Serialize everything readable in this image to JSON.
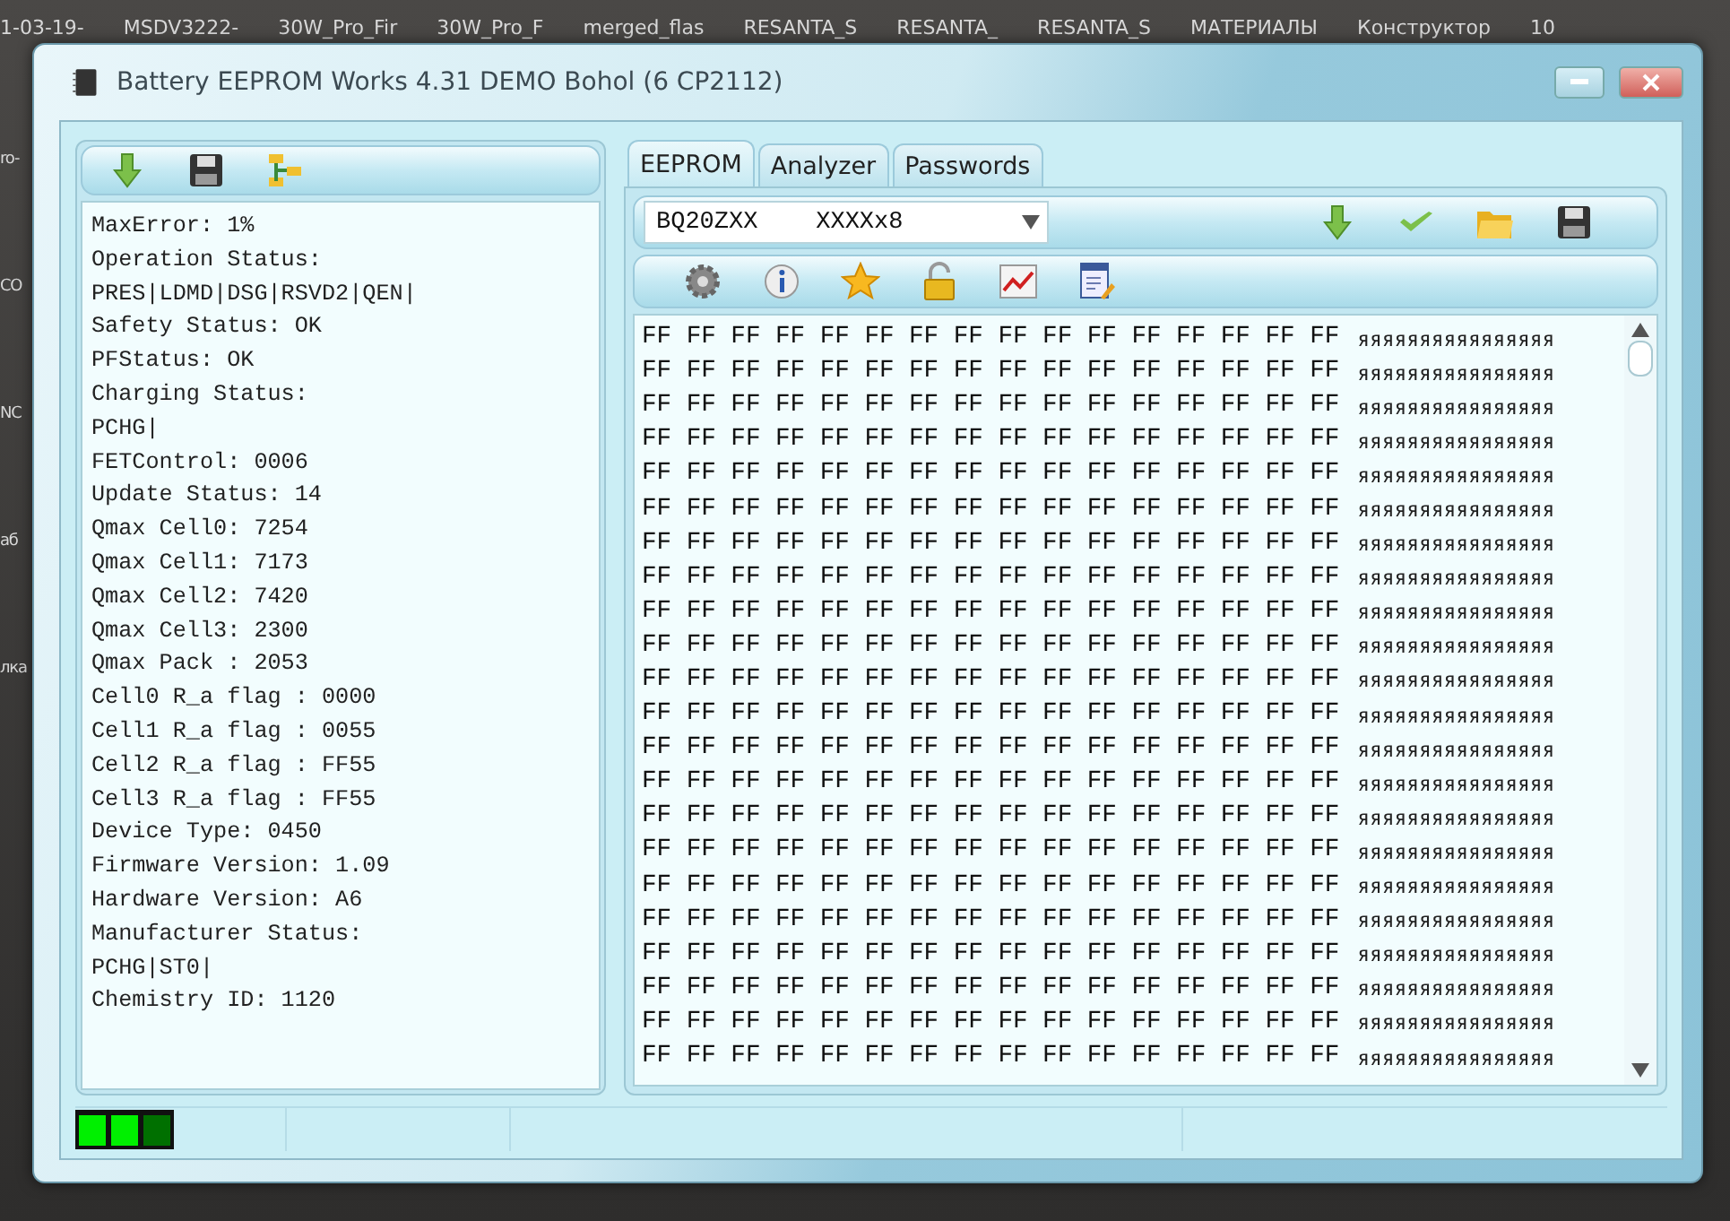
{
  "desktop": {
    "top_labels": [
      "1-03-19-",
      "MSDV3222-",
      "30W_Pro_Fir",
      "30W_Pro_F",
      "merged_flas",
      "RESANTA_S",
      "RESANTA_",
      "RESANTA_S",
      "МАТЕРИАЛЫ",
      "Конструктор",
      "10"
    ],
    "left_labels": [
      "ro-",
      "CO",
      "NC",
      "аб",
      "лка"
    ]
  },
  "window": {
    "title": "Battery EEPROM Works  4.31 DEMO Bohol (6 CP2112)"
  },
  "info_panel": {
    "lines": [
      "MaxError: 1%",
      "Operation Status:",
      "PRES|LDMD|DSG|RSVD2|QEN|",
      "Safety Status: OK",
      "PFStatus: OK",
      "Charging Status:",
      "PCHG|",
      "FETControl: 0006",
      "Update Status: 14",
      "Qmax Cell0: 7254",
      "Qmax Cell1: 7173",
      "Qmax Cell2: 7420",
      "Qmax Cell3: 2300",
      "Qmax Pack : 2053",
      "Cell0 R_a flag : 0000",
      "Cell1 R_a flag : 0055",
      "Cell2 R_a flag : FF55",
      "Cell3 R_a flag : FF55",
      "Device Type: 0450",
      "Firmware Version: 1.09",
      "Hardware Version: A6",
      "Manufacturer Status:",
      "PCHG|ST0|",
      "Chemistry ID: 1120"
    ]
  },
  "tabs": [
    {
      "label": "EEPROM",
      "selected": true
    },
    {
      "label": "Analyzer",
      "selected": false
    },
    {
      "label": "Passwords",
      "selected": false
    }
  ],
  "chip_select": {
    "value": "BQ20ZXX    XXXXx8"
  },
  "hex_view": {
    "rows": [
      {
        "hex": "FF FF FF FF FF FF FF FF FF FF FF FF FF FF FF FF",
        "ascii": "яяяяяяяяяяяяяяяя"
      },
      {
        "hex": "FF FF FF FF FF FF FF FF FF FF FF FF FF FF FF FF",
        "ascii": "яяяяяяяяяяяяяяяя"
      },
      {
        "hex": "FF FF FF FF FF FF FF FF FF FF FF FF FF FF FF FF",
        "ascii": "яяяяяяяяяяяяяяяя"
      },
      {
        "hex": "FF FF FF FF FF FF FF FF FF FF FF FF FF FF FF FF",
        "ascii": "яяяяяяяяяяяяяяяя"
      },
      {
        "hex": "FF FF FF FF FF FF FF FF FF FF FF FF FF FF FF FF",
        "ascii": "яяяяяяяяяяяяяяяя"
      },
      {
        "hex": "FF FF FF FF FF FF FF FF FF FF FF FF FF FF FF FF",
        "ascii": "яяяяяяяяяяяяяяяя"
      },
      {
        "hex": "FF FF FF FF FF FF FF FF FF FF FF FF FF FF FF FF",
        "ascii": "яяяяяяяяяяяяяяяя"
      },
      {
        "hex": "FF FF FF FF FF FF FF FF FF FF FF FF FF FF FF FF",
        "ascii": "яяяяяяяяяяяяяяяя"
      },
      {
        "hex": "FF FF FF FF FF FF FF FF FF FF FF FF FF FF FF FF",
        "ascii": "яяяяяяяяяяяяяяяя"
      },
      {
        "hex": "FF FF FF FF FF FF FF FF FF FF FF FF FF FF FF FF",
        "ascii": "яяяяяяяяяяяяяяяя"
      },
      {
        "hex": "FF FF FF FF FF FF FF FF FF FF FF FF FF FF FF FF",
        "ascii": "яяяяяяяяяяяяяяяя"
      },
      {
        "hex": "FF FF FF FF FF FF FF FF FF FF FF FF FF FF FF FF",
        "ascii": "яяяяяяяяяяяяяяяя"
      },
      {
        "hex": "FF FF FF FF FF FF FF FF FF FF FF FF FF FF FF FF",
        "ascii": "яяяяяяяяяяяяяяяя"
      },
      {
        "hex": "FF FF FF FF FF FF FF FF FF FF FF FF FF FF FF FF",
        "ascii": "яяяяяяяяяяяяяяяя"
      },
      {
        "hex": "FF FF FF FF FF FF FF FF FF FF FF FF FF FF FF FF",
        "ascii": "яяяяяяяяяяяяяяяя"
      },
      {
        "hex": "FF FF FF FF FF FF FF FF FF FF FF FF FF FF FF FF",
        "ascii": "яяяяяяяяяяяяяяяя"
      },
      {
        "hex": "FF FF FF FF FF FF FF FF FF FF FF FF FF FF FF FF",
        "ascii": "яяяяяяяяяяяяяяяя"
      },
      {
        "hex": "FF FF FF FF FF FF FF FF FF FF FF FF FF FF FF FF",
        "ascii": "яяяяяяяяяяяяяяяя"
      },
      {
        "hex": "FF FF FF FF FF FF FF FF FF FF FF FF FF FF FF FF",
        "ascii": "яяяяяяяяяяяяяяяя"
      },
      {
        "hex": "FF FF FF FF FF FF FF FF FF FF FF FF FF FF FF FF",
        "ascii": "яяяяяяяяяяяяяяяя"
      },
      {
        "hex": "FF FF FF FF FF FF FF FF FF FF FF FF FF FF FF FF",
        "ascii": "яяяяяяяяяяяяяяяя"
      },
      {
        "hex": "FF FF FF FF FF FF FF FF FF FF FF FF FF FF FF FF",
        "ascii": "яяяяяяяяяяяяяяяя"
      }
    ]
  },
  "status_bar": {
    "leds": [
      {
        "on": true
      },
      {
        "on": true
      },
      {
        "on": false
      }
    ]
  }
}
